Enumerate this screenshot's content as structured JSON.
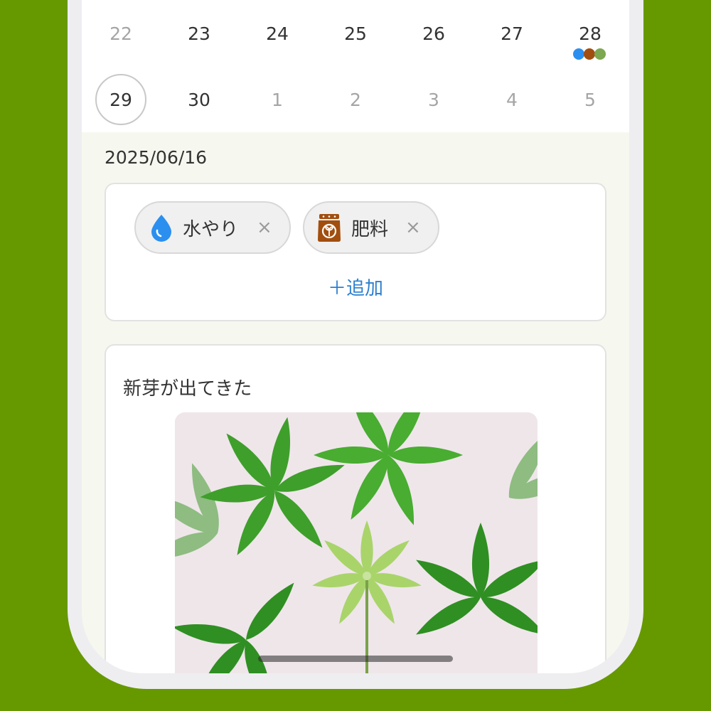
{
  "calendar": {
    "week1": [
      "22",
      "23",
      "24",
      "25",
      "26",
      "27",
      "28"
    ],
    "week2": [
      "29",
      "30",
      "1",
      "2",
      "3",
      "4",
      "5"
    ],
    "event_dots_day": "28",
    "event_dot_colors": [
      "#2b8ff0",
      "#a24e0f",
      "#7ba850"
    ]
  },
  "selected_date": "2025/06/16",
  "tasks": {
    "items": [
      {
        "label": "水やり",
        "icon": "water-drop-icon",
        "color": "#2b8ff0"
      },
      {
        "label": "肥料",
        "icon": "fertilizer-bag-icon",
        "color": "#a24e0f"
      }
    ],
    "remove_glyph": "×",
    "add_label": "＋追加"
  },
  "note": {
    "text": "新芽が出てきた",
    "photo": "plant-photo-schefflera"
  },
  "colors": {
    "background": "#669900",
    "accent_link": "#2b7fd0"
  }
}
